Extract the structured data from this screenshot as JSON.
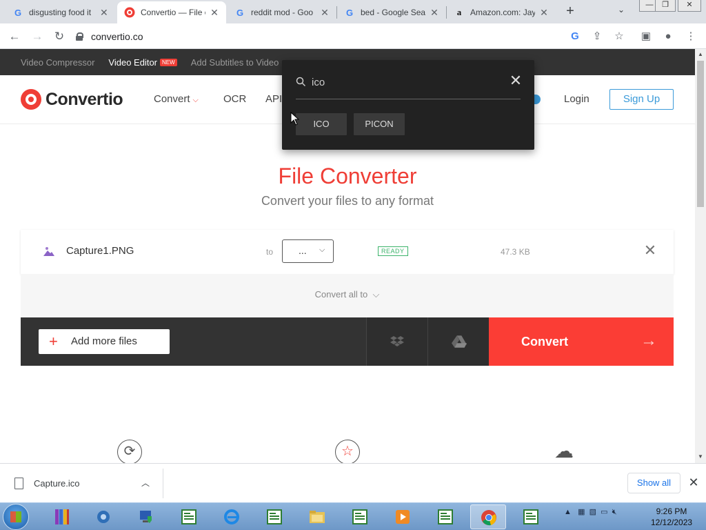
{
  "browser": {
    "tabs": [
      {
        "title": "disgusting food it",
        "favicon": "G",
        "active": false
      },
      {
        "title": "Convertio — File c",
        "favicon": "convertio",
        "active": true
      },
      {
        "title": "reddit mod - Goo",
        "favicon": "G",
        "active": false
      },
      {
        "title": "bed - Google Sea",
        "favicon": "G",
        "active": false
      },
      {
        "title": "Amazon.com: Jay",
        "favicon": "a",
        "active": false
      }
    ],
    "url": "convertio.co"
  },
  "site": {
    "promo_links": [
      "Video Compressor",
      "Video Editor",
      "Add Subtitles to Video"
    ],
    "new_badge": "NEW",
    "logo_text": "Convertio",
    "nav": {
      "convert": "Convert",
      "ocr": "OCR",
      "api": "API"
    },
    "login": "Login",
    "signup": "Sign Up",
    "title": "File Converter",
    "subtitle": "Convert your files to any format",
    "file": {
      "name": "Capture1.PNG",
      "to_label": "to",
      "format_value": "...",
      "status": "READY",
      "size": "47.3 KB"
    },
    "convert_all": "Convert all to",
    "add_more": "Add more files",
    "convert_button": "Convert"
  },
  "format_search": {
    "query": "ico",
    "results": [
      "ICO",
      "PICON"
    ]
  },
  "downloads": {
    "file": "Capture.ico",
    "show_all": "Show all"
  },
  "taskbar": {
    "time": "9:26 PM",
    "date": "12/12/2023"
  },
  "colors": {
    "brand_red": "#ef3e36",
    "accent_blue": "#3a9ad9",
    "ready_green": "#3bb36a"
  }
}
